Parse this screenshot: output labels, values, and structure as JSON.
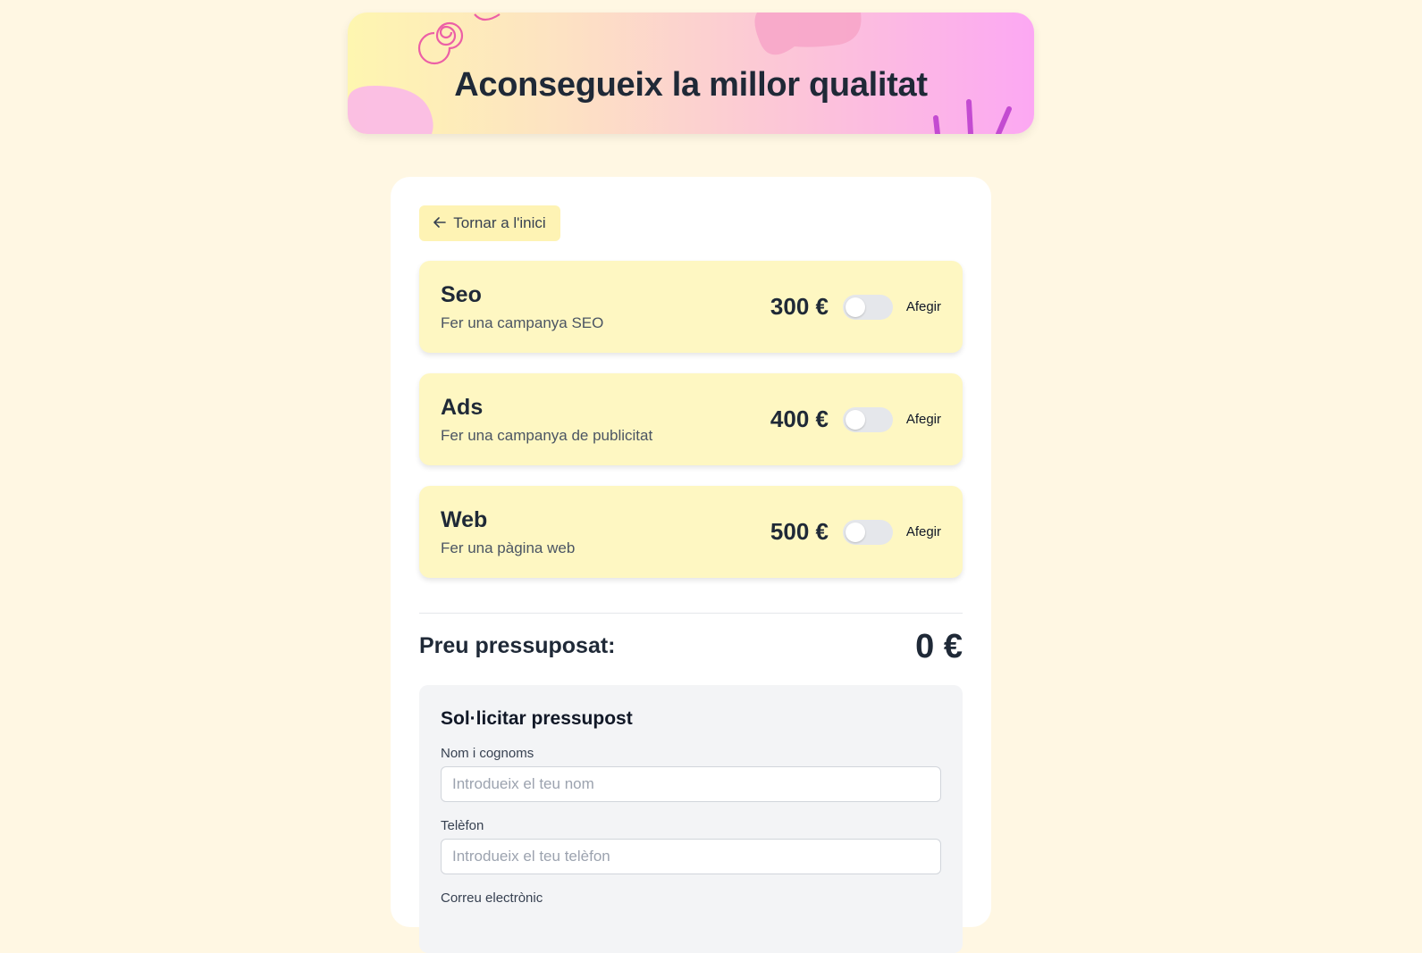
{
  "hero": {
    "title": "Aconsegueix la millor qualitat"
  },
  "back_button": {
    "icon": "arrow-left-icon",
    "label": "Tornar a l'inici"
  },
  "services": [
    {
      "name": "Seo",
      "description": "Fer una campanya SEO",
      "price": "300 €",
      "enabled": false,
      "toggle_label": "Afegir"
    },
    {
      "name": "Ads",
      "description": "Fer una campanya de publicitat",
      "price": "400 €",
      "enabled": false,
      "toggle_label": "Afegir"
    },
    {
      "name": "Web",
      "description": "Fer una pàgina web",
      "price": "500 €",
      "enabled": false,
      "toggle_label": "Afegir"
    }
  ],
  "total": {
    "label": "Preu pressuposat:",
    "value": "0 €"
  },
  "form": {
    "title": "Sol·licitar pressupost",
    "fields": [
      {
        "label": "Nom i cognoms",
        "placeholder": "Introdueix el teu nom",
        "value": ""
      },
      {
        "label": "Telèfon",
        "placeholder": "Introdueix el teu telèfon",
        "value": ""
      },
      {
        "label": "Correu electrònic"
      }
    ]
  },
  "colors": {
    "page_background": "#fff7e3",
    "service_card": "#fef7c2",
    "accent_pink": "#fca8f3",
    "text_dark": "#1f2937"
  }
}
